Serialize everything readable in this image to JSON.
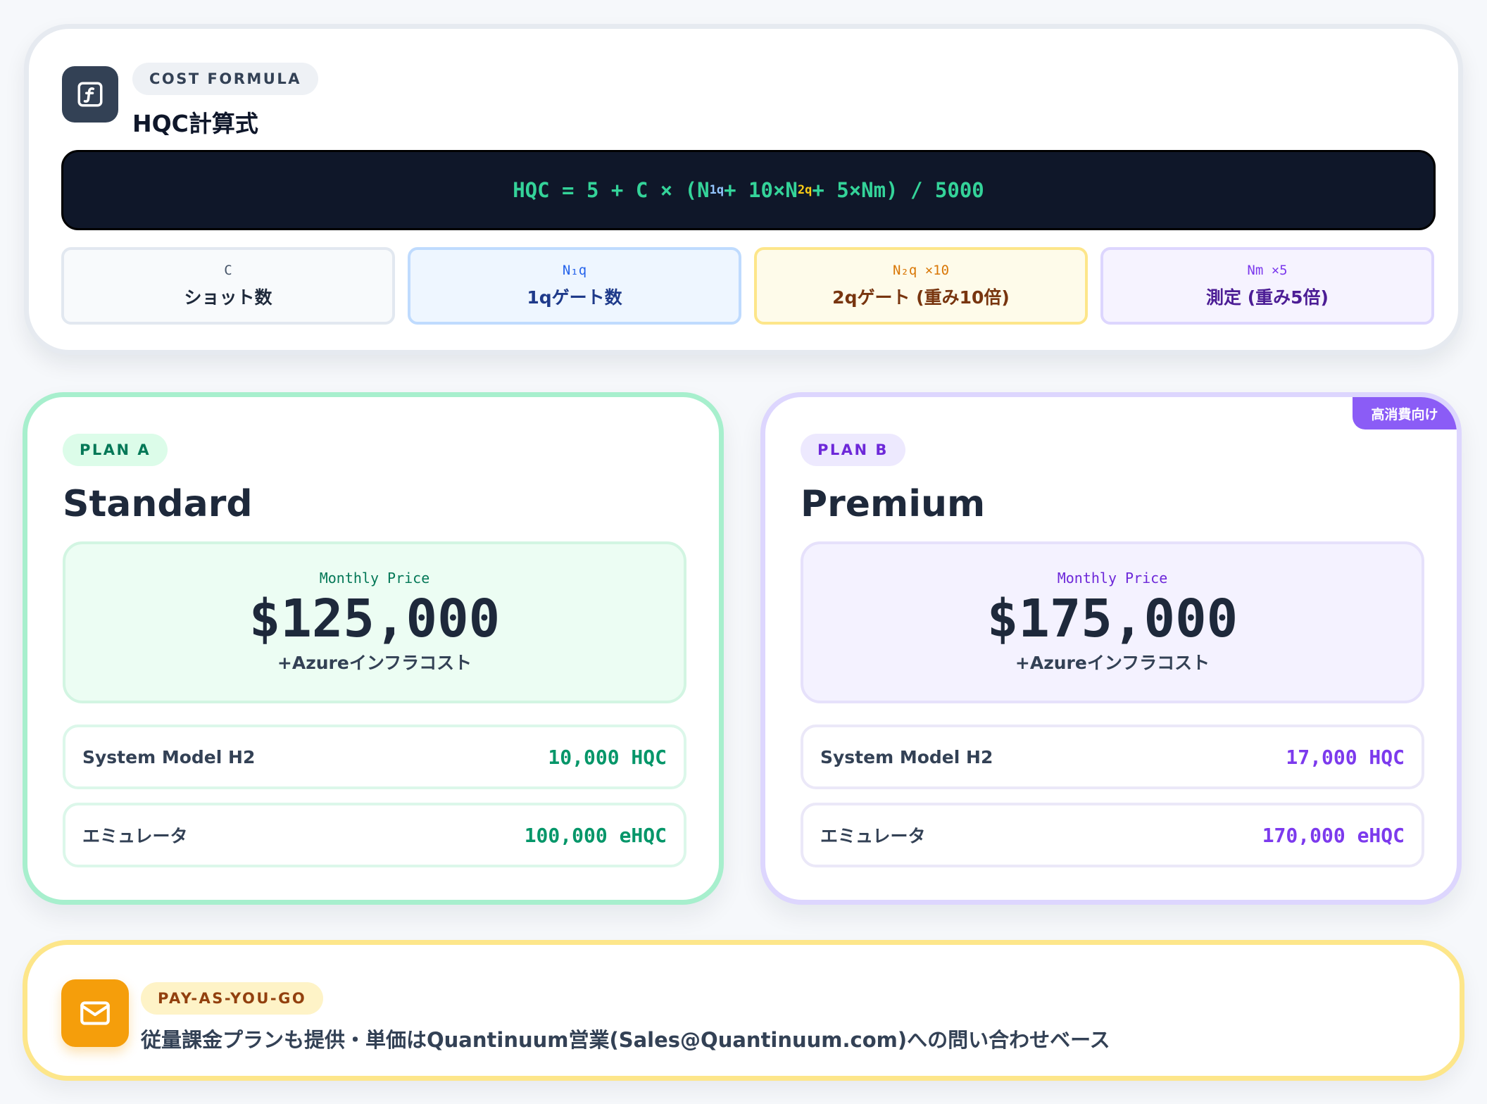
{
  "formula": {
    "pill": "COST FORMULA",
    "title": "HQC計算式",
    "icon": "function-icon",
    "expr": {
      "p1": "HQC = 5 + C × (N",
      "s1": "1q",
      "p2": " + 10×N",
      "s2": "2q",
      "p3": " + 5×N",
      "s3": "m",
      "p4": ") / 5000"
    },
    "vars": [
      {
        "symbol": "C",
        "desc": "ショット数"
      },
      {
        "symbol": "N₁q",
        "desc": "1qゲート数"
      },
      {
        "symbol": "N₂q ×10",
        "desc": "2qゲート (重み10倍)"
      },
      {
        "symbol": "Nm ×5",
        "desc": "測定 (重み5倍)"
      }
    ]
  },
  "plans": [
    {
      "tag": "PLAN A",
      "name": "Standard",
      "price_label": "Monthly Price",
      "price": "$125,000",
      "price_note": "+Azureインフラコスト",
      "rows": [
        {
          "label": "System Model H2",
          "value": "10,000 HQC"
        },
        {
          "label": "エミュレータ",
          "value": "100,000 eHQC"
        }
      ]
    },
    {
      "tag": "PLAN B",
      "name": "Premium",
      "badge": "高消費向け",
      "price_label": "Monthly Price",
      "price": "$175,000",
      "price_note": "+Azureインフラコスト",
      "rows": [
        {
          "label": "System Model H2",
          "value": "17,000 HQC"
        },
        {
          "label": "エミュレータ",
          "value": "170,000 eHQC"
        }
      ]
    }
  ],
  "payg": {
    "pill": "PAY-AS-YOU-GO",
    "icon": "mail-icon",
    "text": "従量課金プランも提供・単価はQuantinuum営業(Sales@Quantinuum.com)への問い合わせベース"
  },
  "colors": {
    "plan_a_accent": "#059669",
    "plan_b_accent": "#7c3aed",
    "payg_accent": "#f59e0b",
    "formula_bg": "#0f1729"
  }
}
